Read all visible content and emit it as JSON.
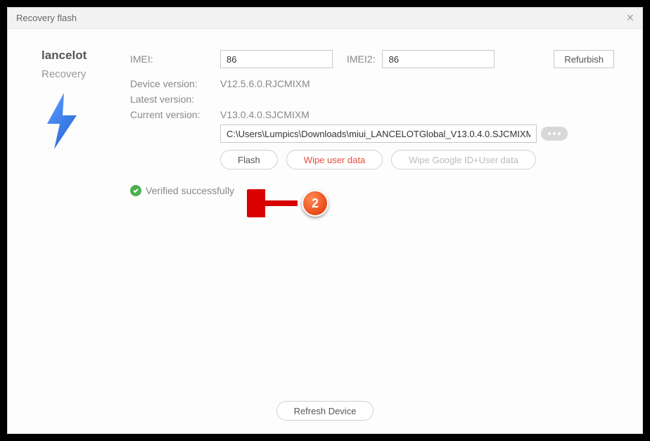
{
  "window": {
    "title": "Recovery flash"
  },
  "device": {
    "name": "lancelot",
    "mode": "Recovery"
  },
  "imei": {
    "label": "IMEI:",
    "value": "86",
    "label2": "IMEI2:",
    "value2": "86"
  },
  "versions": {
    "device_label": "Device version:",
    "device_value": "V12.5.6.0.RJCMIXM",
    "latest_label": "Latest version:",
    "latest_value": "",
    "current_label": "Current version:",
    "current_value": "V13.0.4.0.SJCMIXM"
  },
  "path": {
    "value": "C:\\Users\\Lumpics\\Downloads\\miui_LANCELOTGlobal_V13.0.4.0.SJCMIXM_..."
  },
  "buttons": {
    "refurbish": "Refurbish",
    "flash": "Flash",
    "wipe_user": "Wipe user data",
    "wipe_google": "Wipe Google ID+User data",
    "refresh": "Refresh Device"
  },
  "status": {
    "text": "Verified successfully"
  },
  "annotation": {
    "number": "2"
  }
}
